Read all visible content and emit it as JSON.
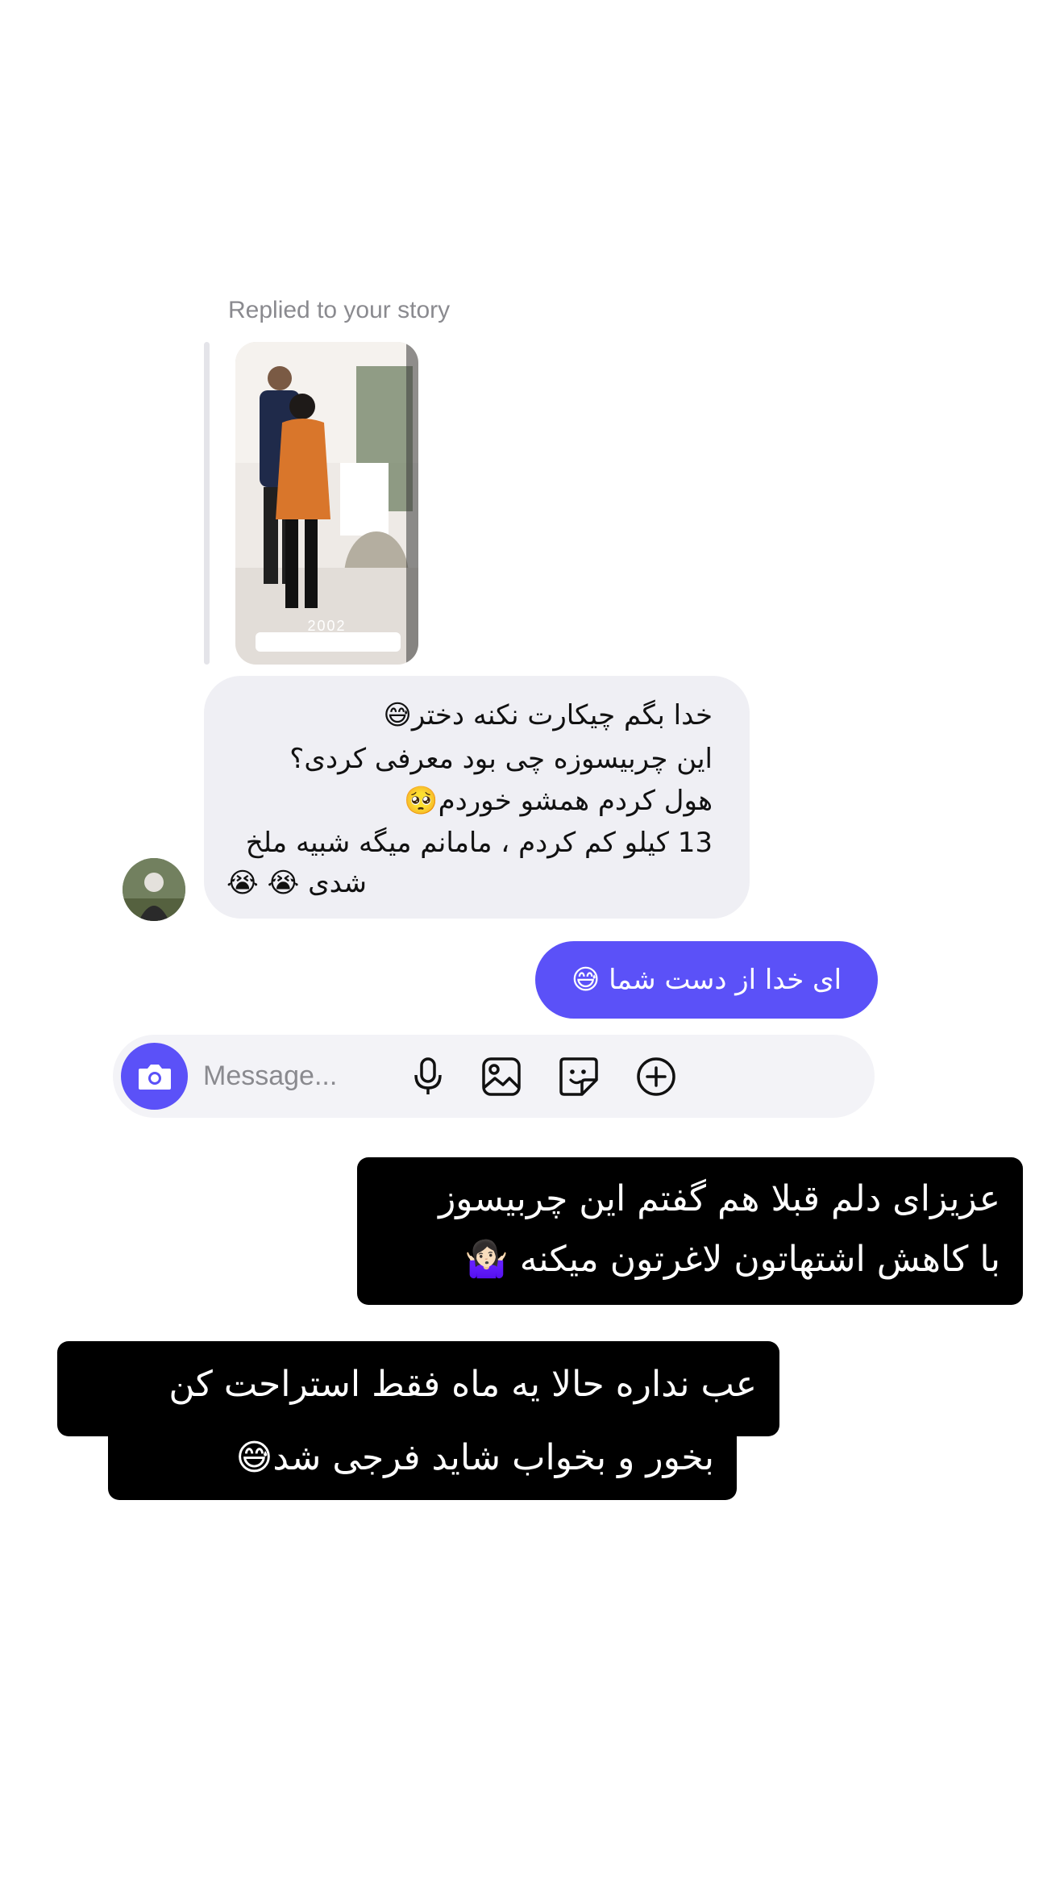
{
  "thread": {
    "reply_header": "Replied to your story",
    "story_overlay_text": "2002",
    "incoming_message": {
      "lines": [
        "خدا بگم چیکارت نکنه دختر😅",
        "این چربیسوزه چی بود معرفی کردی؟",
        "هول کردم همشو خوردم🥺",
        "13 کیلو کم کردم ، مامانم میگه شبیه ملخ",
        "شدی 😭 😭"
      ]
    },
    "outgoing_message": {
      "text": "ای خدا از دست شما 😅"
    }
  },
  "composer": {
    "placeholder": "Message...",
    "icons": {
      "camera": "camera-icon",
      "mic": "microphone-icon",
      "gallery": "image-icon",
      "sticker": "sticker-icon",
      "add": "plus-circle-icon"
    }
  },
  "captions": [
    {
      "lines": [
        "عزیزای دلم قبلا هم گفتم این چربیسوز",
        "با کاهش اشتهاتون لاغرتون میکنه 🤷🏻‍♀️"
      ]
    },
    {
      "lines": [
        "عب نداره حالا یه ماه فقط استراحت کن",
        "بخور و بخواب شاید فرجی شد😅"
      ]
    }
  ],
  "colors": {
    "accent": "#5b51f8",
    "incoming_bubble": "#efeff4",
    "composer_bg": "#f3f3f7",
    "caption_bg": "#000000",
    "secondary_text": "#8a8a8f"
  }
}
